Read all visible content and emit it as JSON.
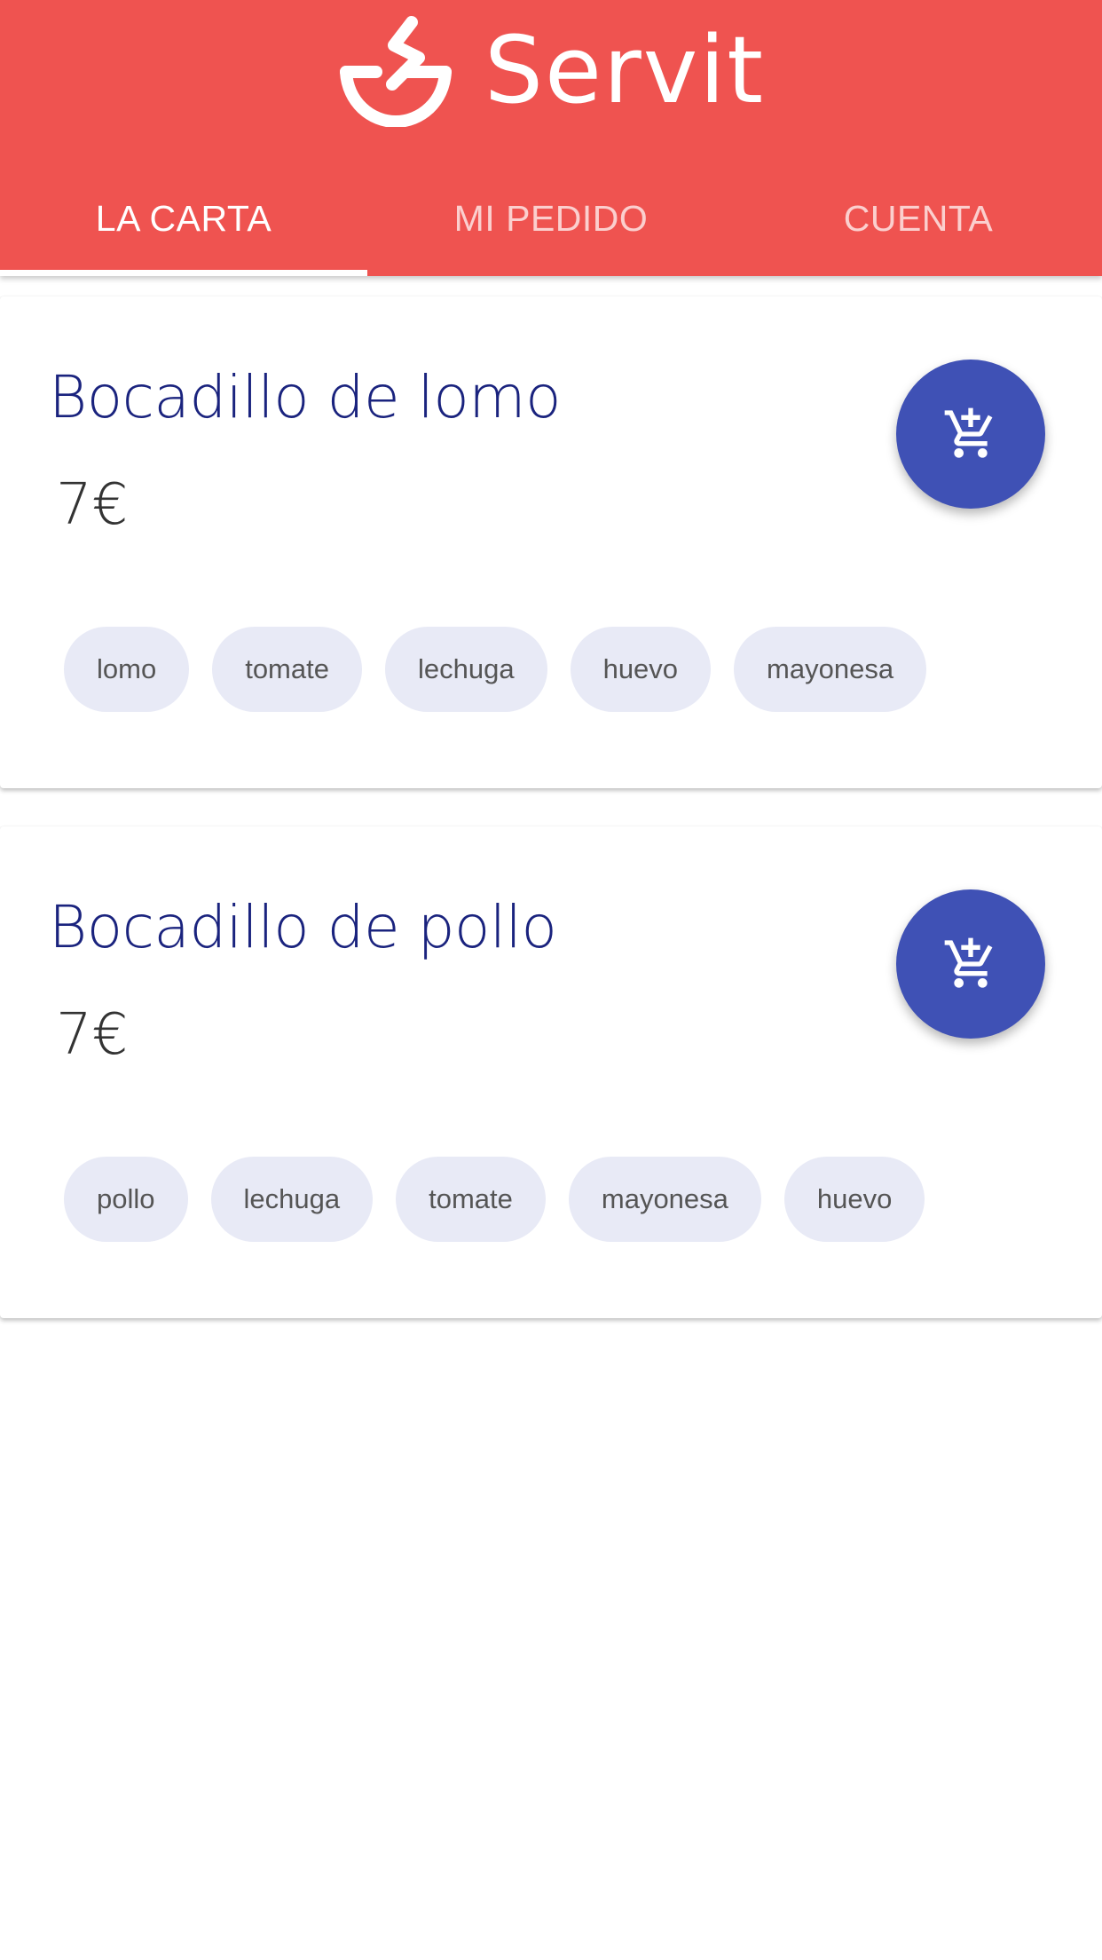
{
  "app": {
    "name": "Servit",
    "logo_icon": "servit-bowl-logo",
    "colors": {
      "primary": "#EF5350",
      "accent": "#3F51B5",
      "title": "#1A237E",
      "chip_bg": "#E8EAF6"
    }
  },
  "tabs": [
    {
      "label": "LA CARTA",
      "active": true
    },
    {
      "label": "MI PEDIDO",
      "active": false
    },
    {
      "label": "CUENTA",
      "active": false
    }
  ],
  "menu_items": [
    {
      "name": "Bocadillo de lomo",
      "price": "7€",
      "cart_icon": "add-shopping-cart-icon",
      "ingredients": [
        "lomo",
        "tomate",
        "lechuga",
        "huevo",
        "mayonesa"
      ]
    },
    {
      "name": "Bocadillo de pollo",
      "price": "7€",
      "cart_icon": "add-shopping-cart-icon",
      "ingredients": [
        "pollo",
        "lechuga",
        "tomate",
        "mayonesa",
        "huevo"
      ]
    }
  ]
}
